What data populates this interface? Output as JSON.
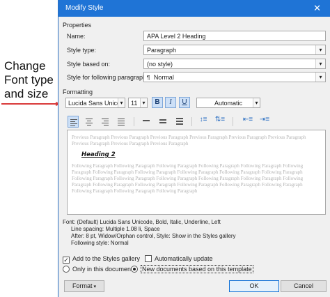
{
  "annotation": {
    "line1": "Change",
    "line2": "Font type",
    "line3": "and size"
  },
  "window": {
    "title": "Modify Style",
    "close_glyph": "✕"
  },
  "properties": {
    "section_label": "Properties",
    "name_label": "Name:",
    "name_value": "APA Level 2 Heading",
    "style_type_label": "Style type:",
    "style_type_value": "Paragraph",
    "style_based_on_label": "Style based on:",
    "style_based_on_value": "(no style)",
    "following_label": "Style for following paragraph:",
    "following_mark": "¶",
    "following_value": "Normal"
  },
  "formatting": {
    "section_label": "Formatting",
    "font_name": "Lucida Sans Unicode",
    "font_size": "11",
    "bold": "B",
    "italic": "I",
    "underline": "U",
    "color": "Automatic"
  },
  "preview": {
    "previous_text": "Previous Paragraph Previous Paragraph Previous Paragraph Previous Paragraph Previous Paragraph Previous Paragraph Previous Paragraph Previous Paragraph Previous Paragraph",
    "heading": "Heading 2",
    "following_text": "Following Paragraph Following Paragraph Following Paragraph Following Paragraph Following Paragraph Following Paragraph Following Paragraph Following Paragraph Following Paragraph Following Paragraph Following Paragraph Following Paragraph Following Paragraph Following Paragraph Following Paragraph Following Paragraph Following Paragraph Following Paragraph Following Paragraph Following Paragraph Following Paragraph Following Paragraph Following Paragraph Following Paragraph Following Paragraph"
  },
  "description": {
    "line1": "Font: (Default) Lucida Sans Unicode, Bold, Italic, Underline, Left",
    "line2": "Line spacing:  Multiple 1.08 li, Space",
    "line3": "After:  8 pt, Widow/Orphan control, Style: Show in the Styles gallery",
    "line4": "Following style: Normal"
  },
  "options": {
    "add_to_gallery": "Add to the Styles gallery",
    "auto_update": "Automatically update",
    "only_this_doc": "Only in this document",
    "new_docs": "New documents based on this template"
  },
  "buttons": {
    "format": "Format",
    "ok": "OK",
    "cancel": "Cancel"
  },
  "colors": {
    "accent": "#1f74d6",
    "arrow": "#d93a3a"
  }
}
